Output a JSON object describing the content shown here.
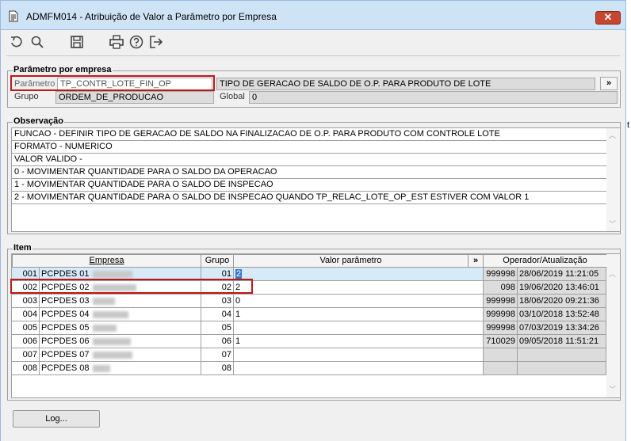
{
  "window": {
    "title": "ADMFM014 - Atribuição de Valor a Parâmetro por Empresa",
    "close_label": "✕"
  },
  "toolbar": {
    "icons": [
      "undo-icon",
      "search-icon",
      "save-icon",
      "print-icon",
      "help-icon",
      "exit-icon"
    ]
  },
  "parametro_section": {
    "legend": "Parâmetro por empresa",
    "parametro_label": "Parâmetro",
    "parametro_value": "TP_CONTR_LOTE_FIN_OP",
    "descricao_value": "TIPO DE GERACAO DE SALDO DE O.P. PARA PRODUTO DE LOTE",
    "expand_label": "»",
    "grupo_label": "Grupo",
    "grupo_value": "ORDEM_DE_PRODUCAO",
    "global_label": "Global",
    "global_value": "0"
  },
  "observacao_section": {
    "legend": "Observação",
    "lines": [
      "FUNCAO - DEFINIR TIPO DE GERACAO DE SALDO NA FINALIZACAO DE O.P. PARA PRODUTO COM CONTROLE LOTE",
      "FORMATO - NUMERICO",
      "VALOR VALIDO -",
      "0 - MOVIMENTAR QUANTIDADE PARA O SALDO DA OPERACAO",
      "1 - MOVIMENTAR QUANTIDADE PARA O SALDO DE INSPECAO",
      "2 - MOVIMENTAR QUANTIDADE PARA O SALDO DE INSPECAO QUANDO TP_RELAC_LOTE_OP_EST ESTIVER COM VALOR 1"
    ]
  },
  "item_section": {
    "legend": "Item",
    "columns": {
      "empresa": "Empresa",
      "grupo": "Grupo",
      "valor": "Valor parâmetro",
      "expand": "»",
      "operador": "Operador/Atualização"
    },
    "rows": [
      {
        "code": "001",
        "empresa": "PCPDES 01",
        "grupo": "01",
        "valor": "2",
        "operador": "999998",
        "atualizacao": "28/06/2019 11:21:05"
      },
      {
        "code": "002",
        "empresa": "PCPDES 02",
        "grupo": "02",
        "valor": "2",
        "operador": "098",
        "atualizacao": "19/06/2020 13:46:01"
      },
      {
        "code": "003",
        "empresa": "PCPDES 03",
        "grupo": "03",
        "valor": "0",
        "operador": "999998",
        "atualizacao": "18/06/2020 09:21:36"
      },
      {
        "code": "004",
        "empresa": "PCPDES 04",
        "grupo": "04",
        "valor": "1",
        "operador": "999998",
        "atualizacao": "03/10/2018 13:52:48"
      },
      {
        "code": "005",
        "empresa": "PCPDES 05",
        "grupo": "05",
        "valor": "",
        "operador": "999998",
        "atualizacao": "07/03/2019 13:34:26"
      },
      {
        "code": "006",
        "empresa": "PCPDES 06",
        "grupo": "06",
        "valor": "1",
        "operador": "710029",
        "atualizacao": "09/05/2018 11:51:21"
      },
      {
        "code": "007",
        "empresa": "PCPDES 07",
        "grupo": "07",
        "valor": "",
        "operador": "",
        "atualizacao": ""
      },
      {
        "code": "008",
        "empresa": "PCPDES 08",
        "grupo": "08",
        "valor": "",
        "operador": "",
        "atualizacao": ""
      }
    ]
  },
  "log_button": {
    "label": "Log..."
  },
  "edge_fragment": "t"
}
